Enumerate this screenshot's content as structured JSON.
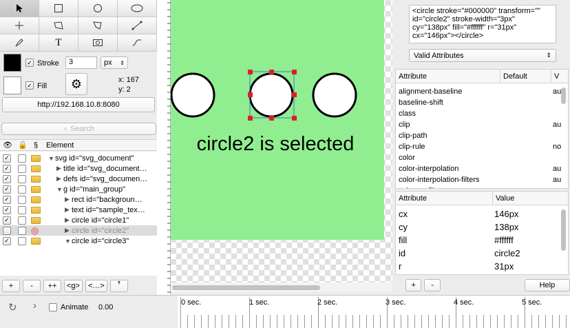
{
  "toolbar": {
    "tools": [
      "select",
      "rect",
      "circle",
      "ellipse",
      "crosshair",
      "path",
      "polygon",
      "line",
      "pen",
      "text",
      "image",
      "curve"
    ],
    "stroke_label": "Stroke",
    "stroke_width": "3",
    "stroke_unit": "px",
    "fill_label": "Fill",
    "coord_x": "x: 167",
    "coord_y": "y: 2",
    "url": "http://192.168.10.8:8080",
    "search_placeholder": "Search"
  },
  "tree": {
    "header_element": "Element",
    "header_section": "§",
    "rows": [
      {
        "label": "svg id=\"svg_document\"",
        "indent": 0,
        "expanded": true
      },
      {
        "label": "title id=\"svg_document…",
        "indent": 1,
        "expanded": false
      },
      {
        "label": "defs id=\"svg_documen…",
        "indent": 1,
        "expanded": false
      },
      {
        "label": "g id=\"main_group\"",
        "indent": 1,
        "expanded": true
      },
      {
        "label": "rect id=\"backgroun…",
        "indent": 2,
        "expanded": false
      },
      {
        "label": "text id=\"sample_tex…",
        "indent": 2,
        "expanded": false
      },
      {
        "label": "circle id=\"circle1\"",
        "indent": 2,
        "expanded": false
      },
      {
        "label": "circle id=\"circle2\"",
        "indent": 2,
        "expanded": false,
        "selected": true
      },
      {
        "label": "circle id=\"circle3\"",
        "indent": 2,
        "expanded": true
      }
    ],
    "buttons": [
      "+",
      "-",
      "++",
      "<g>",
      "<…>",
      "ꜛ"
    ]
  },
  "canvas": {
    "background": "#90ee90",
    "caption": "circle2 is selected",
    "selected_id": "circle2"
  },
  "inspector": {
    "code": "<circle stroke=\"#000000\" transform=\"\" id=\"circle2\" stroke-width=\"3px\" cy=\"138px\" fill=\"#ffffff\" r=\"31px\" cx=\"146px\"></circle>",
    "popup_value": "Valid Attributes",
    "attr_headers": [
      "Attribute",
      "Default",
      "V"
    ],
    "attr_list": [
      {
        "name": "alignment-baseline",
        "v": "au"
      },
      {
        "name": "baseline-shift",
        "v": ""
      },
      {
        "name": "class",
        "v": ""
      },
      {
        "name": "clip",
        "v": "au"
      },
      {
        "name": "clip-path",
        "v": ""
      },
      {
        "name": "clip-rule",
        "v": "no"
      },
      {
        "name": "color",
        "v": ""
      },
      {
        "name": "color-interpolation",
        "v": "au"
      },
      {
        "name": "color-interpolation-filters",
        "v": "au"
      },
      {
        "name": "color-profile",
        "v": ""
      }
    ],
    "value_headers": [
      "Attribute",
      "Value"
    ],
    "values": [
      {
        "attr": "cx",
        "value": "146px"
      },
      {
        "attr": "cy",
        "value": "138px"
      },
      {
        "attr": "fill",
        "value": "#ffffff"
      },
      {
        "attr": "id",
        "value": "circle2"
      },
      {
        "attr": "r",
        "value": "31px"
      }
    ],
    "help": "Help",
    "add": "+",
    "remove": "-"
  },
  "timeline": {
    "animate_label": "Animate",
    "time": "0.00",
    "ticks": [
      "0 sec.",
      "1 sec.",
      "2 sec.",
      "3 sec.",
      "4 sec.",
      "5 sec."
    ]
  }
}
